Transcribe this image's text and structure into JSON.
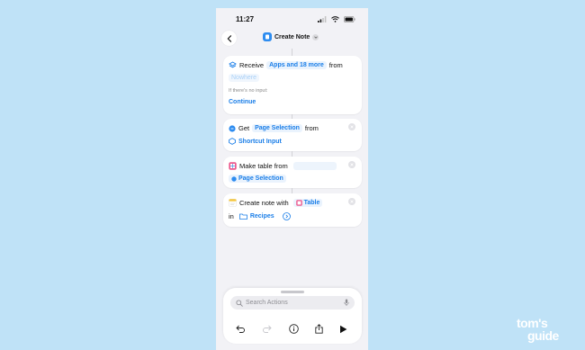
{
  "status_bar": {
    "time": "11:27"
  },
  "header": {
    "title": "Create Note"
  },
  "actions": [
    {
      "verb": "Receive",
      "token": "Apps and 18 more",
      "connector": "from",
      "source": "Nowhere",
      "subtitle": "If there's no input:",
      "fallback": "Continue"
    },
    {
      "verb": "Get",
      "token": "Page Selection",
      "connector": "from",
      "source": "Shortcut Input"
    },
    {
      "verb": "Make table from",
      "token": "Page Selection"
    },
    {
      "verb": "Create note with",
      "token": "Table",
      "connector": "in",
      "folder": "Recipes"
    }
  ],
  "search": {
    "placeholder": "Search Actions"
  },
  "toolbar": {
    "icons": [
      "undo-icon",
      "redo-icon",
      "info-icon",
      "share-icon",
      "play-icon"
    ]
  },
  "watermark": {
    "line1": "tom's",
    "line2": "guide"
  },
  "colors": {
    "accent": "#1a7ee8",
    "background": "#bfe2f7",
    "phone": "#f2f2f6"
  }
}
